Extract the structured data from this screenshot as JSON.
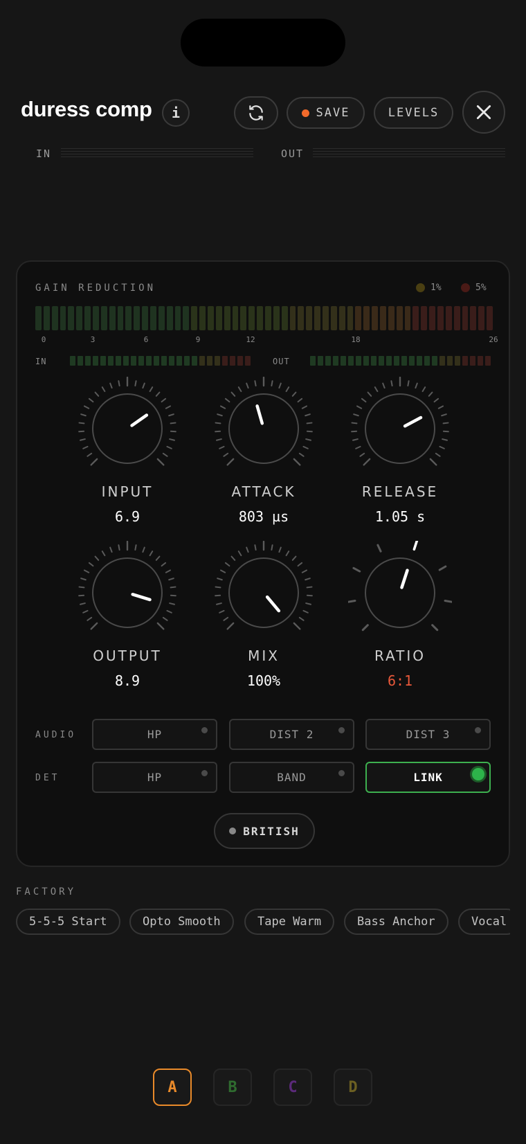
{
  "header": {
    "title": "duress comp",
    "info_icon": "info-icon",
    "info_glyph": "i",
    "sync_icon": "sync-icon",
    "save_label": "SAVE",
    "save_dot_color": "#f26a2b",
    "levels_label": "LEVELS",
    "close_icon": "close-icon"
  },
  "io": {
    "in_label": "IN",
    "out_label": "OUT"
  },
  "gain_reduction": {
    "title": "GAIN REDUCTION",
    "legend": [
      {
        "label": "1%",
        "color": "#4a3f12"
      },
      {
        "label": "5%",
        "color": "#4a1a16"
      }
    ],
    "ticks": [
      "0",
      "3",
      "6",
      "9",
      "12",
      "18",
      "26"
    ],
    "in_label": "IN",
    "out_label": "OUT"
  },
  "knobs": [
    {
      "label": "INPUT",
      "value": "6.9"
    },
    {
      "label": "ATTACK",
      "value": "803 µs"
    },
    {
      "label": "RELEASE",
      "value": "1.05 s"
    },
    {
      "label": "OUTPUT",
      "value": "8.9"
    },
    {
      "label": "MIX",
      "value": "100%"
    },
    {
      "label": "RATIO",
      "value": "6:1",
      "value_color": "#e8583a"
    }
  ],
  "audio_row": {
    "label": "AUDIO",
    "toggles": [
      {
        "label": "HP",
        "on": false
      },
      {
        "label": "DIST 2",
        "on": false
      },
      {
        "label": "DIST 3",
        "on": false
      }
    ]
  },
  "det_row": {
    "label": "DET",
    "toggles": [
      {
        "label": "HP",
        "on": false
      },
      {
        "label": "BAND",
        "on": false
      },
      {
        "label": "LINK",
        "on": true
      }
    ]
  },
  "character": {
    "label": "BRITISH"
  },
  "factory": {
    "label": "FACTORY",
    "presets": [
      "5-5-5 Start",
      "Opto Smooth",
      "Tape Warm",
      "Bass Anchor",
      "Vocal"
    ]
  },
  "slots": [
    {
      "label": "A",
      "color": "#e98a2a",
      "active": true
    },
    {
      "label": "B",
      "color": "#2f6b2f",
      "active": false
    },
    {
      "label": "C",
      "color": "#5b2a7a",
      "active": false
    },
    {
      "label": "D",
      "color": "#6b5f22",
      "active": false
    }
  ],
  "accent": {
    "green": "#2db34a",
    "orange": "#f26a2b"
  }
}
